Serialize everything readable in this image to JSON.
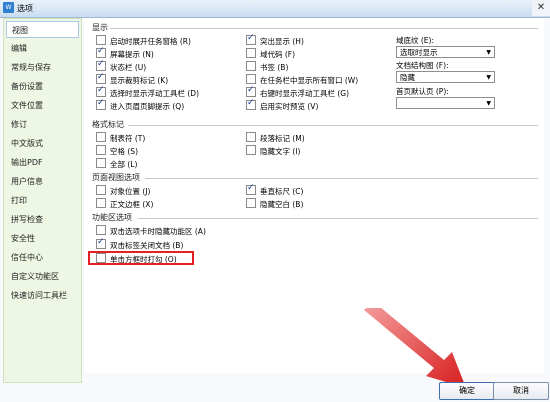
{
  "window": {
    "title": "选项",
    "app_icon": "W",
    "close_glyph": "✕"
  },
  "sidebar": {
    "items": [
      {
        "label": "视图",
        "active": true
      },
      {
        "label": "编辑"
      },
      {
        "label": "常规与保存"
      },
      {
        "label": "备份设置"
      },
      {
        "label": "文件位置"
      },
      {
        "label": "修订"
      },
      {
        "label": "中文版式"
      },
      {
        "label": "输出PDF"
      },
      {
        "label": "用户信息"
      },
      {
        "label": "打印"
      },
      {
        "label": "拼写检查"
      },
      {
        "label": "安全性"
      },
      {
        "label": "信任中心"
      },
      {
        "label": "自定义功能区"
      },
      {
        "label": "快速访问工具栏"
      }
    ]
  },
  "display": {
    "title": "显示",
    "col1": [
      {
        "label": "启动时展开任务窗格 (R)",
        "checked": false
      },
      {
        "label": "屏幕提示 (N)",
        "checked": true
      },
      {
        "label": "状态栏 (U)",
        "checked": true
      },
      {
        "label": "显示裁剪标记 (K)",
        "checked": true
      },
      {
        "label": "选择时显示浮动工具栏 (D)",
        "checked": true
      },
      {
        "label": "进入页眉页脚提示 (Q)",
        "checked": true
      }
    ],
    "col2": [
      {
        "label": "突出显示 (H)",
        "checked": true
      },
      {
        "label": "域代码 (F)",
        "checked": false
      },
      {
        "label": "书签 (B)",
        "checked": false
      },
      {
        "label": "在任务栏中显示所有窗口 (W)",
        "checked": false
      },
      {
        "label": "右键时显示浮动工具栏 (G)",
        "checked": true
      },
      {
        "label": "启用实时预览 (V)",
        "checked": true
      }
    ],
    "field_shading_label": "域底纹 (E):",
    "field_shading_value": "选取时显示",
    "doc_map_label": "文档结构图 (F):",
    "doc_map_value": "隐藏",
    "first_page_label": "首页默认页 (P):",
    "first_page_value": ""
  },
  "format_marks": {
    "title": "格式标记",
    "col1": [
      {
        "label": "制表符 (T)",
        "checked": false
      },
      {
        "label": "空格 (S)",
        "checked": false
      },
      {
        "label": "全部 (L)",
        "checked": false
      }
    ],
    "col2": [
      {
        "label": "段落标记 (M)",
        "checked": false
      },
      {
        "label": "隐藏文字 (I)",
        "checked": false
      }
    ]
  },
  "page_view": {
    "title": "页面视图选项",
    "col1": [
      {
        "label": "对象位置 (J)",
        "checked": false
      },
      {
        "label": "正文边框 (X)",
        "checked": false
      }
    ],
    "col2": [
      {
        "label": "垂直标尺 (C)",
        "checked": true
      },
      {
        "label": "隐藏空白 (B)",
        "checked": false
      }
    ]
  },
  "ribbon": {
    "title": "功能区选项",
    "items": [
      {
        "label": "双击选项卡时隐藏功能区 (A)",
        "checked": false
      },
      {
        "label": "双击标签关闭文档 (B)",
        "checked": true
      },
      {
        "label": "单击方框时打勾 (O)",
        "checked": false
      }
    ]
  },
  "buttons": {
    "ok": "确定",
    "cancel": "取消"
  },
  "colors": {
    "highlight": "#e42023",
    "sidebar_bg": "#eef7e3"
  }
}
